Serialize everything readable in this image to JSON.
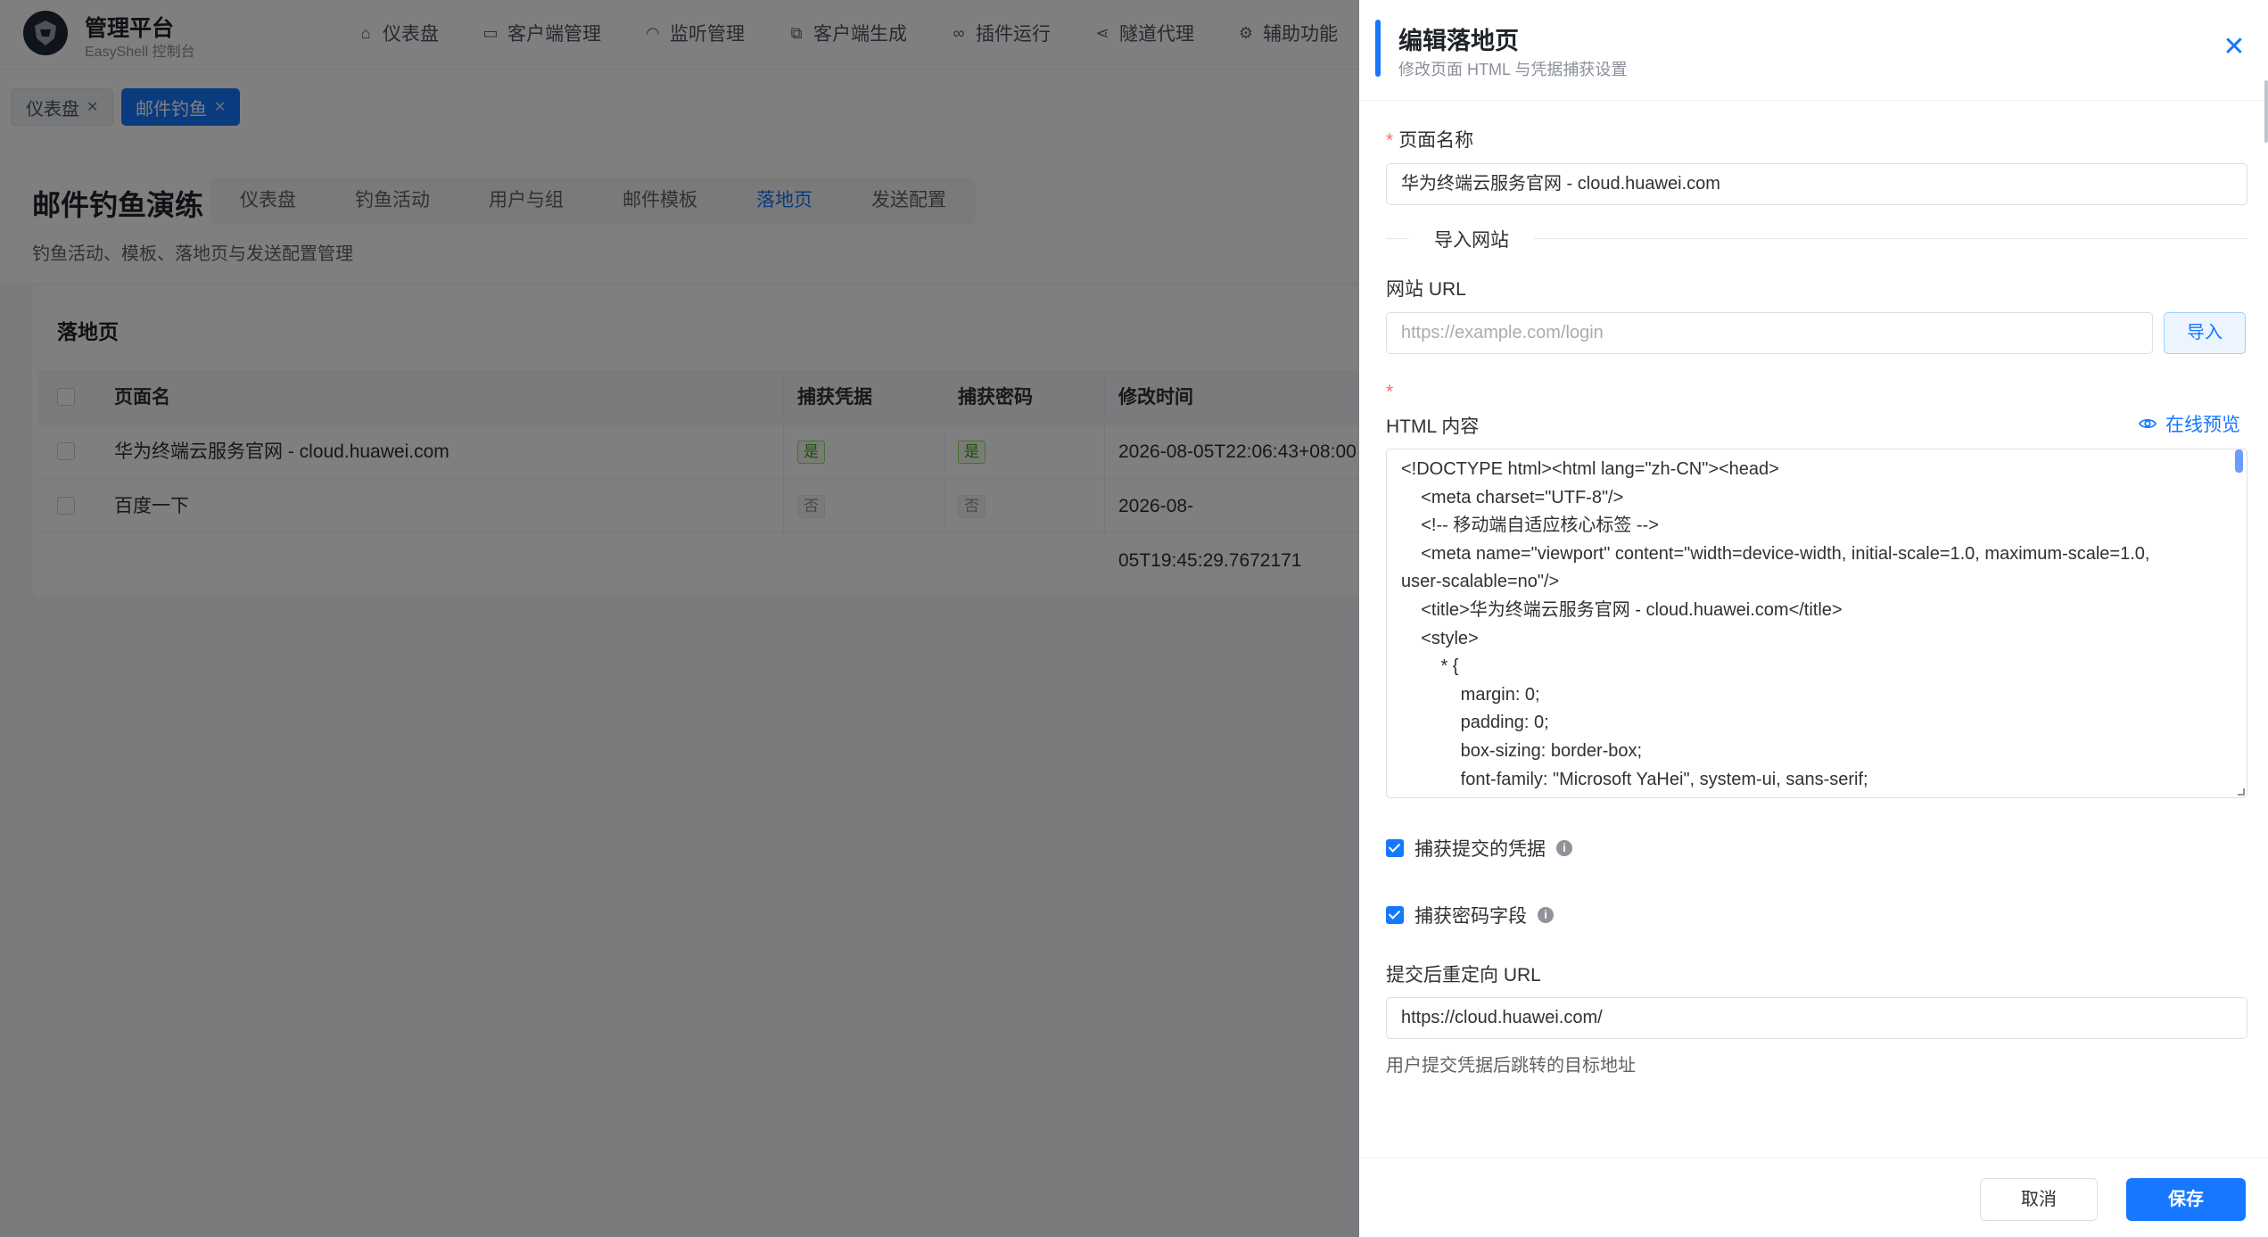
{
  "app": {
    "title": "管理平台",
    "subtitle": "EasyShell 控制台"
  },
  "nav": [
    {
      "label": "仪表盘",
      "icon": "home-icon"
    },
    {
      "label": "客户端管理",
      "icon": "monitor-icon"
    },
    {
      "label": "监听管理",
      "icon": "headset-icon"
    },
    {
      "label": "客户端生成",
      "icon": "generate-icon"
    },
    {
      "label": "插件运行",
      "icon": "link-icon"
    },
    {
      "label": "隧道代理",
      "icon": "share-icon"
    },
    {
      "label": "辅助功能",
      "icon": "gear-icon"
    }
  ],
  "tabs": [
    {
      "label": "仪表盘",
      "active": false
    },
    {
      "label": "邮件钓鱼",
      "active": true
    }
  ],
  "page": {
    "title": "邮件钓鱼演练",
    "description": "钓鱼活动、模板、落地页与发送配置管理",
    "subtabs": [
      "仪表盘",
      "钓鱼活动",
      "用户与组",
      "邮件模板",
      "落地页",
      "发送配置"
    ],
    "active_subtab": "落地页"
  },
  "landing_card": {
    "title": "落地页",
    "columns": [
      "页面名",
      "捕获凭据",
      "捕获密码",
      "修改时间"
    ],
    "rows": [
      {
        "name": "华为终端云服务官网 - cloud.huawei.com",
        "capture_creds": "是",
        "capture_pwd": "是",
        "modified": "2026-08-05T22:06:43+08:00"
      },
      {
        "name": "百度一下",
        "capture_creds": "否",
        "capture_pwd": "否",
        "modified": "2026-08-05T19:45:29.7672171"
      }
    ]
  },
  "drawer": {
    "title": "编辑落地页",
    "subtitle": "修改页面 HTML 与凭据捕获设置",
    "name_label": "页面名称",
    "name_value": "华为终端云服务官网 - cloud.huawei.com",
    "divider_label": "导入网站",
    "url_label": "网站 URL",
    "url_placeholder": "https://example.com/login",
    "import_label": "导入",
    "required_mark": "*",
    "html_label": "HTML 内容",
    "preview_label": "在线预览",
    "html_lines": [
      "<!DOCTYPE html><html lang=\"zh-CN\"><head>",
      "    <meta charset=\"UTF-8\"/>",
      "    <!-- 移动端自适应核心标签 -->",
      "    <meta name=\"viewport\" content=\"width=device-width, initial-scale=1.0, maximum-scale=1.0,",
      "user-scalable=no\"/>",
      "    <title>华为终端云服务官网 - cloud.huawei.com</title>",
      "    <style>",
      "        * {",
      "            margin: 0;",
      "            padding: 0;",
      "            box-sizing: border-box;",
      "            font-family: \"Microsoft YaHei\", system-ui, sans-serif;"
    ],
    "capture_creds_label": "捕获提交的凭据",
    "capture_pwd_label": "捕获密码字段",
    "redirect_label": "提交后重定向 URL",
    "redirect_value": "https://cloud.huawei.com/",
    "redirect_hint": "用户提交凭据后跳转的目标地址",
    "cancel_label": "取消",
    "save_label": "保存"
  },
  "colors": {
    "accent": "#1677ff",
    "success": "#389e0d",
    "danger": "#f56c6c"
  }
}
